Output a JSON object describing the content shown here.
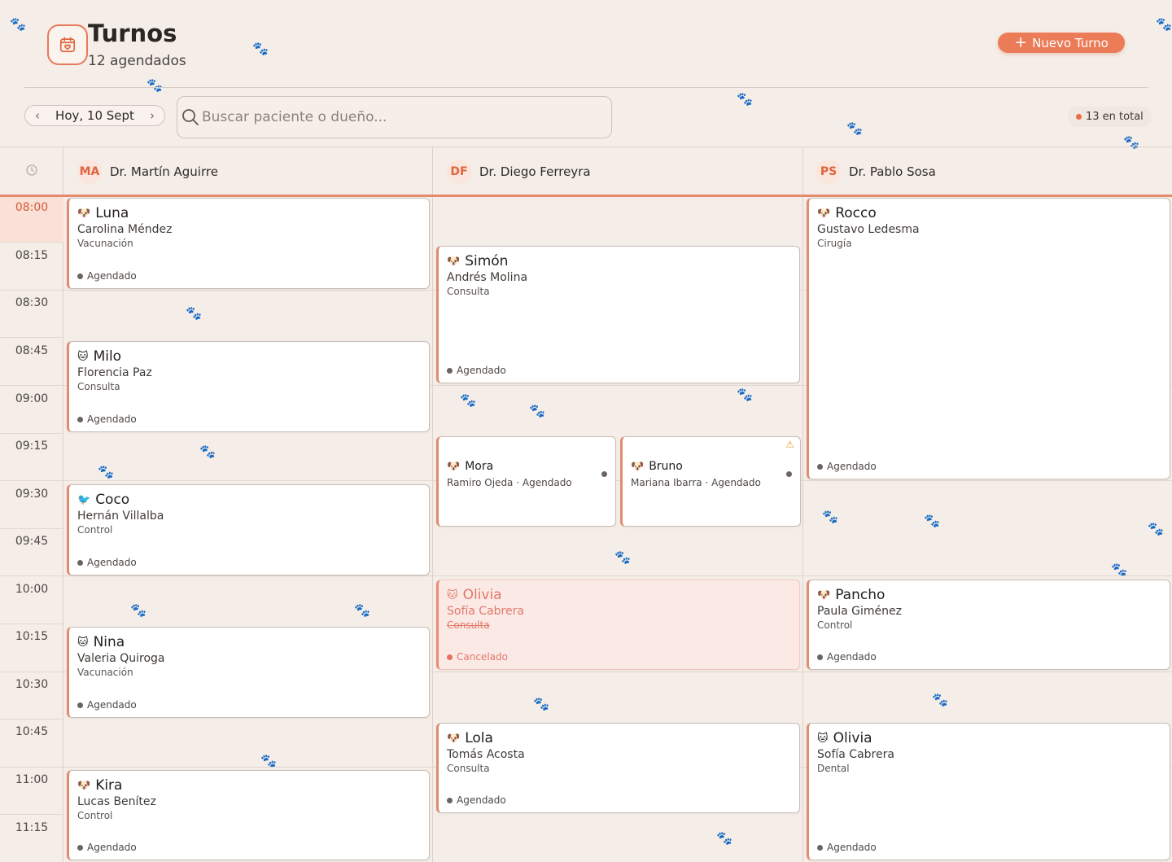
{
  "header": {
    "title": "Turnos",
    "subtitle": "12 agendados",
    "new_button": "Nuevo Turno",
    "logo_icon": "calendar-heart-icon"
  },
  "toolbar": {
    "date_label": "Hoy, 10 Sept",
    "search_placeholder": "Buscar paciente o dueño...",
    "total_label": "13 en total"
  },
  "colors": {
    "accent": "#ec7b57",
    "background": "#f5ede7",
    "cancel": "#e2786a"
  },
  "doctors": [
    {
      "initials": "MA",
      "name": "Dr. Martín Aguirre"
    },
    {
      "initials": "DF",
      "name": "Dr. Diego Ferreyra"
    },
    {
      "initials": "PS",
      "name": "Dr. Pablo Sosa"
    }
  ],
  "times": [
    "08:00",
    "08:15",
    "08:30",
    "08:45",
    "09:00",
    "09:15",
    "09:30",
    "09:45",
    "10:00",
    "10:15",
    "10:30",
    "10:45",
    "11:00",
    "11:15"
  ],
  "appointments": {
    "luna": {
      "pet": "Luna",
      "owner": "Carolina Méndez",
      "type": "Vacunación",
      "status": "Agendado",
      "icon": "🐶"
    },
    "milo": {
      "pet": "Milo",
      "owner": "Florencia Paz",
      "type": "Consulta",
      "status": "Agendado",
      "icon": "🐱"
    },
    "coco": {
      "pet": "Coco",
      "owner": "Hernán Villalba",
      "type": "Control",
      "status": "Agendado",
      "icon": "🐦"
    },
    "nina": {
      "pet": "Nina",
      "owner": "Valeria Quiroga",
      "type": "Vacunación",
      "status": "Agendado",
      "icon": "🐱"
    },
    "kira": {
      "pet": "Kira",
      "owner": "Lucas Benítez",
      "type": "Control",
      "status": "Agendado",
      "icon": "🐶"
    },
    "simon": {
      "pet": "Simón",
      "owner": "Andrés Molina",
      "type": "Consulta",
      "status": "Agendado",
      "icon": "🐶"
    },
    "mora": {
      "pet": "Mora",
      "owner": "Ramiro Ojeda",
      "status": "Agendado",
      "icon": "🐶"
    },
    "bruno": {
      "pet": "Bruno",
      "owner": "Mariana Ibarra",
      "status": "Agendado",
      "icon": "🐶"
    },
    "olivia1": {
      "pet": "Olivia",
      "owner": "Sofía Cabrera",
      "type": "Consulta",
      "status": "Cancelado",
      "icon": "🐱"
    },
    "lola": {
      "pet": "Lola",
      "owner": "Tomás Acosta",
      "type": "Consulta",
      "status": "Agendado",
      "icon": "🐶"
    },
    "rocco": {
      "pet": "Rocco",
      "owner": "Gustavo Ledesma",
      "type": "Cirugía",
      "status": "Agendado",
      "icon": "🐶"
    },
    "pancho": {
      "pet": "Pancho",
      "owner": "Paula Giménez",
      "type": "Control",
      "status": "Agendado",
      "icon": "🐶"
    },
    "olivia2": {
      "pet": "Olivia",
      "owner": "Sofía Cabrera",
      "type": "Dental",
      "status": "Agendado",
      "icon": "🐱"
    }
  },
  "meta_separator": "·",
  "warning_icon": "⚠",
  "plus_icon": "+",
  "prev_icon": "‹",
  "next_icon": "›"
}
